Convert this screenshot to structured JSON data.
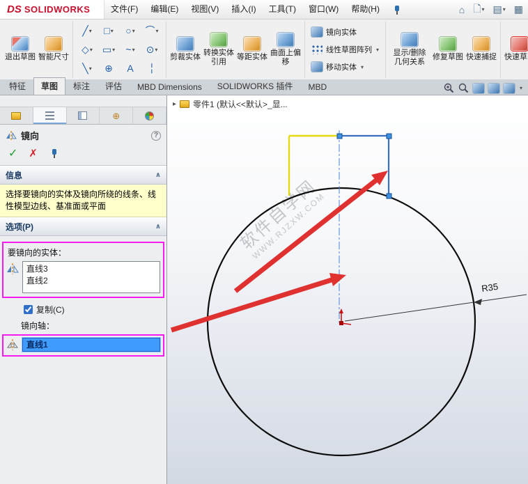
{
  "titlebar": {
    "logo_ds": "DS",
    "logo_name": "SOLIDWORKS",
    "menus": [
      "文件(F)",
      "编辑(E)",
      "视图(V)",
      "插入(I)",
      "工具(T)",
      "窗口(W)",
      "帮助(H)"
    ]
  },
  "ribbon": {
    "exit_sketch": "退出草图",
    "smart_dimension": "智能尺寸",
    "trim_entities": "剪裁实体",
    "convert_entities": "转换实体引用",
    "offset_entities": "等距实体",
    "surface_offset": "曲面上偏移",
    "mirror_entities": "镜向实体",
    "linear_pattern": "线性草图阵列",
    "move_entities": "移动实体",
    "display_delete_relations": "显示/删除几何关系",
    "repair_sketch": "修复草图",
    "quick_snaps": "快速捕捉",
    "rapid_sketch": "快速草图"
  },
  "tabs": {
    "items": [
      "特征",
      "草图",
      "标注",
      "评估",
      "MBD Dimensions",
      "SOLIDWORKS 插件",
      "MBD"
    ],
    "active_index": 1
  },
  "property_panel": {
    "title": "镜向",
    "info_header": "信息",
    "info_message": "选择要镜向的实体及镜向所绕的线条、线性模型边线、基准面或平面",
    "options_header": "选项(P)",
    "entities_label": "要镜向的实体：",
    "entities": [
      "直线3",
      "直线2"
    ],
    "copy_checkbox_label": "复制(C)",
    "mirror_axis_label": "镜向轴：",
    "mirror_axis_value": "直线1"
  },
  "graphics": {
    "breadcrumb": "零件1 (默认<<默认>_显...",
    "dimension_label": "R35",
    "watermark_line1": "软件自学网",
    "watermark_line2": "WWW.RJZXW.COM"
  },
  "icons": {
    "dropdown": "▾",
    "breadcrumb_arrow": "▸",
    "ok": "✓",
    "cancel": "✗",
    "help": "?",
    "collapse": "∧",
    "home": "⌂"
  }
}
